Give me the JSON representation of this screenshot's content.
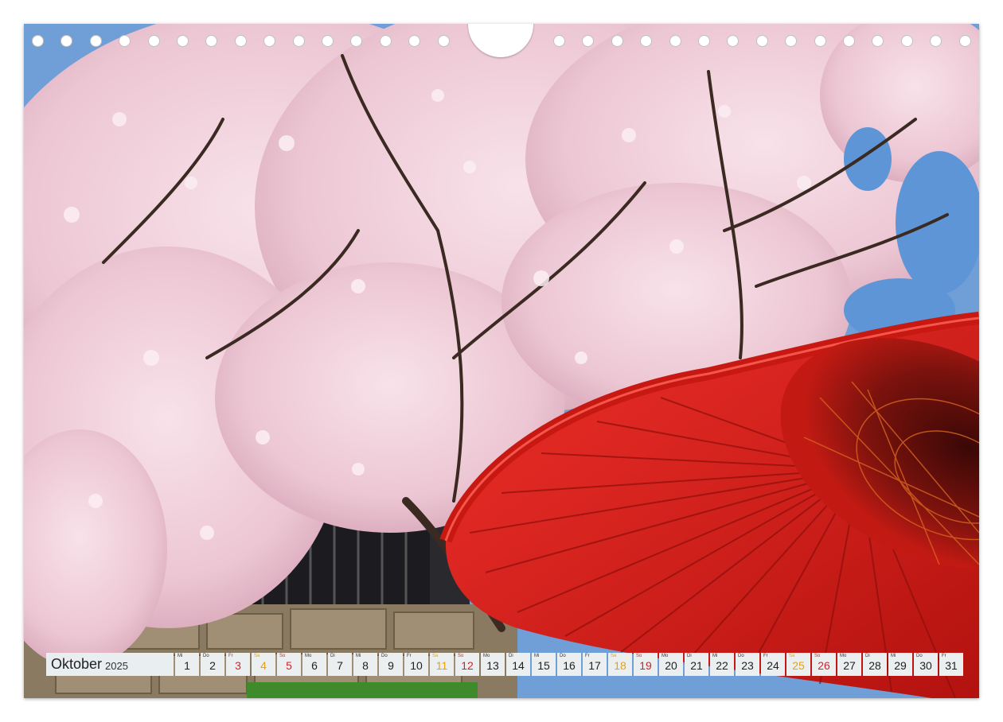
{
  "calendar": {
    "month": "Oktober",
    "year": "2025",
    "days": [
      {
        "dow": "Mi",
        "num": "1",
        "type": "weekday"
      },
      {
        "dow": "Do",
        "num": "2",
        "type": "weekday"
      },
      {
        "dow": "Fr",
        "num": "3",
        "type": "holiday"
      },
      {
        "dow": "Sa",
        "num": "4",
        "type": "sat"
      },
      {
        "dow": "So",
        "num": "5",
        "type": "sun"
      },
      {
        "dow": "Mo",
        "num": "6",
        "type": "weekday"
      },
      {
        "dow": "Di",
        "num": "7",
        "type": "weekday"
      },
      {
        "dow": "Mi",
        "num": "8",
        "type": "weekday"
      },
      {
        "dow": "Do",
        "num": "9",
        "type": "weekday"
      },
      {
        "dow": "Fr",
        "num": "10",
        "type": "weekday"
      },
      {
        "dow": "Sa",
        "num": "11",
        "type": "sat"
      },
      {
        "dow": "So",
        "num": "12",
        "type": "sun"
      },
      {
        "dow": "Mo",
        "num": "13",
        "type": "weekday"
      },
      {
        "dow": "Di",
        "num": "14",
        "type": "weekday"
      },
      {
        "dow": "Mi",
        "num": "15",
        "type": "weekday"
      },
      {
        "dow": "Do",
        "num": "16",
        "type": "weekday"
      },
      {
        "dow": "Fr",
        "num": "17",
        "type": "weekday"
      },
      {
        "dow": "Sa",
        "num": "18",
        "type": "sat"
      },
      {
        "dow": "So",
        "num": "19",
        "type": "sun"
      },
      {
        "dow": "Mo",
        "num": "20",
        "type": "weekday"
      },
      {
        "dow": "Di",
        "num": "21",
        "type": "weekday"
      },
      {
        "dow": "Mi",
        "num": "22",
        "type": "weekday"
      },
      {
        "dow": "Do",
        "num": "23",
        "type": "weekday"
      },
      {
        "dow": "Fr",
        "num": "24",
        "type": "weekday"
      },
      {
        "dow": "Sa",
        "num": "25",
        "type": "sat"
      },
      {
        "dow": "So",
        "num": "26",
        "type": "sun"
      },
      {
        "dow": "Mo",
        "num": "27",
        "type": "weekday"
      },
      {
        "dow": "Di",
        "num": "28",
        "type": "weekday"
      },
      {
        "dow": "Mi",
        "num": "29",
        "type": "weekday"
      },
      {
        "dow": "Do",
        "num": "30",
        "type": "weekday"
      },
      {
        "dow": "Fr",
        "num": "31",
        "type": "weekday"
      }
    ]
  },
  "colors": {
    "umbrella_red": "#e0221b",
    "blossom_pink": "#f2d0dc",
    "sky_blue": "#5b8fd0",
    "saturday": "#e8a012",
    "sunday": "#d42027"
  }
}
